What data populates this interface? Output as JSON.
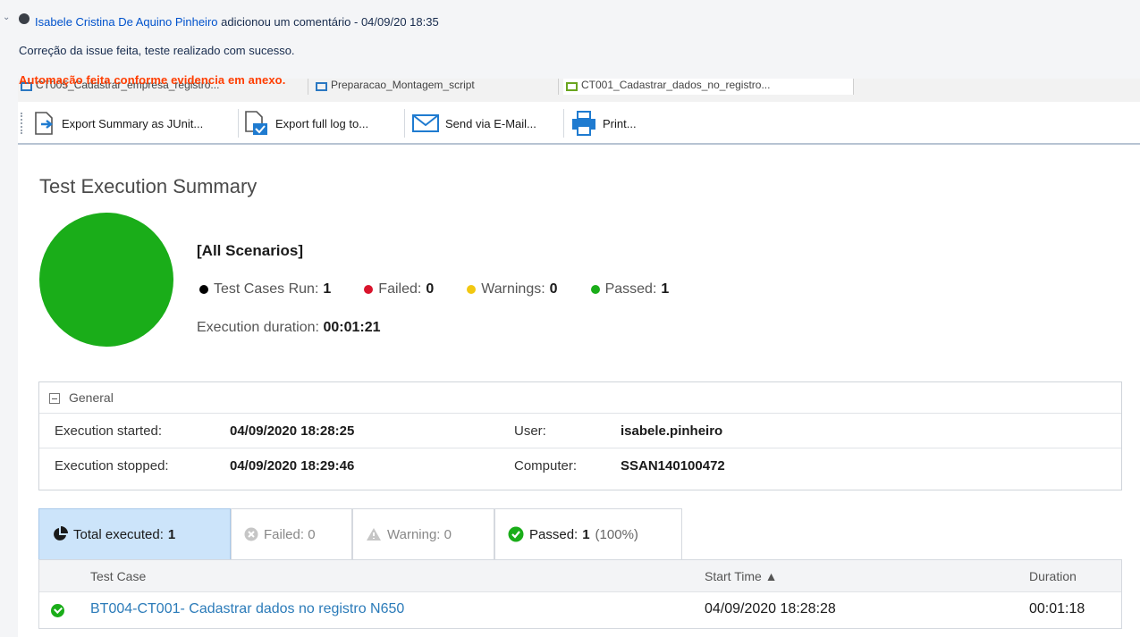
{
  "comment": {
    "author": "Isabele Cristina De Aquino Pinheiro",
    "action": "adicionou um comentário - 04/09/20 18:35",
    "body": "Correção da issue feita, teste realizado com sucesso.",
    "highlight": "Automação feita conforme evidencia em anexo."
  },
  "tabs": [
    {
      "label": "CT005_Cadastrar_empresa_registro..."
    },
    {
      "label": "Preparacao_Montagem_script"
    },
    {
      "label": "CT001_Cadastrar_dados_no_registro..."
    }
  ],
  "toolbar": {
    "export_junit": "Export Summary as JUnit...",
    "export_log": "Export full log to...",
    "send_email": "Send via E-Mail...",
    "print": "Print..."
  },
  "summary": {
    "title": "Test Execution Summary",
    "scenario": "[All Scenarios]",
    "stats": [
      {
        "label": "Test Cases Run:",
        "value": "1",
        "color": "#000000"
      },
      {
        "label": "Failed:",
        "value": "0",
        "color": "#d9142c"
      },
      {
        "label": "Warnings:",
        "value": "0",
        "color": "#f2c811"
      },
      {
        "label": "Passed:",
        "value": "1",
        "color": "#1aad19"
      }
    ],
    "duration_label": "Execution duration:",
    "duration_value": "00:01:21",
    "pie_color": "#1aad19",
    "passed_fraction": 1.0
  },
  "general": {
    "heading": "General",
    "started_label": "Execution started:",
    "started_value": "04/09/2020 18:28:25",
    "stopped_label": "Execution stopped:",
    "stopped_value": "04/09/2020 18:29:46",
    "user_label": "User:",
    "user_value": "isabele.pinheiro",
    "computer_label": "Computer:",
    "computer_value": "SSAN140100472"
  },
  "filter_tabs": {
    "total_label": "Total executed:",
    "total_value": "1",
    "failed": "Failed: 0",
    "warning": "Warning: 0",
    "passed_label": "Passed:",
    "passed_value": "1",
    "passed_pct": "(100%)"
  },
  "results": {
    "columns": {
      "test_case": "Test Case",
      "start_time": "Start Time ▲",
      "duration": "Duration"
    },
    "rows": [
      {
        "name": "BT004-CT001- Cadastrar dados no registro N650",
        "start": "04/09/2020 18:28:28",
        "duration": "00:01:18"
      }
    ]
  }
}
